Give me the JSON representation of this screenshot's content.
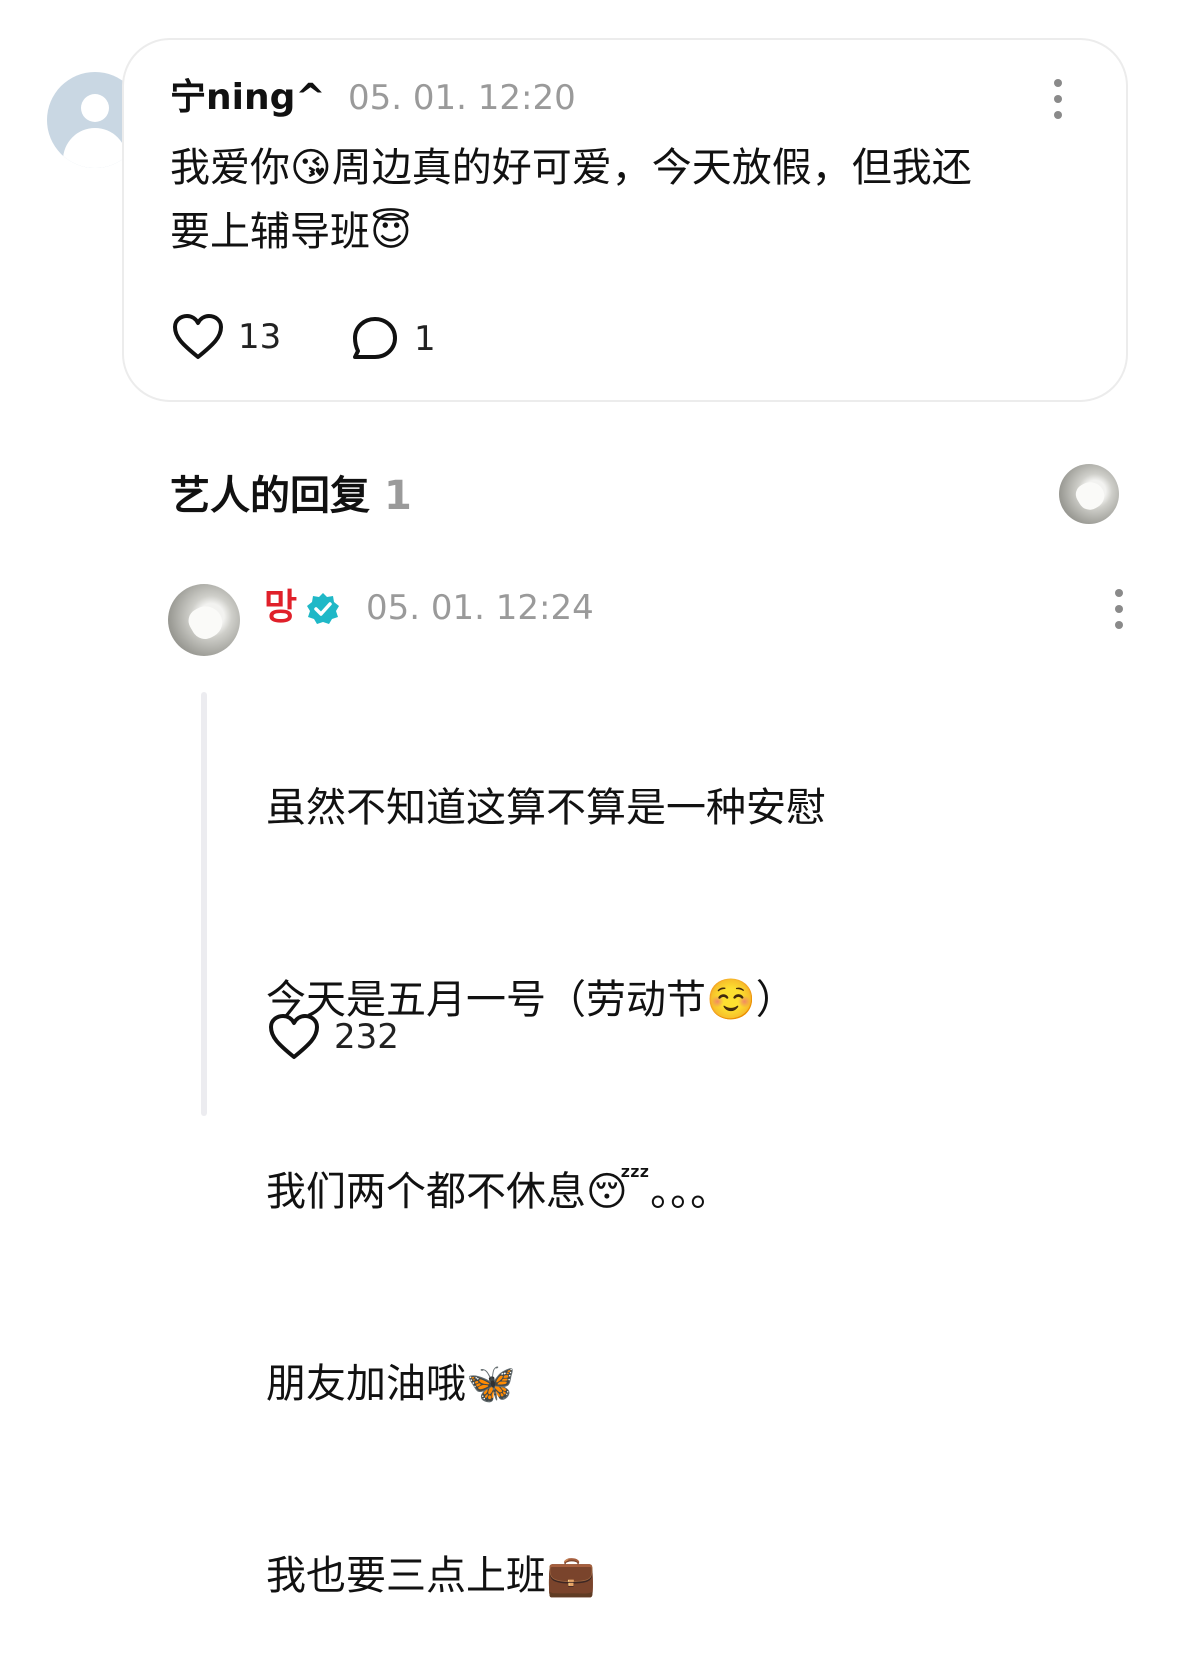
{
  "comment": {
    "username": "宁ning^",
    "time": "05. 01. 12:20",
    "text": "我爱你😘周边真的好可爱，今天放假，但我还\n要上辅导班😇",
    "likes": "13",
    "replies": "1",
    "icons": {
      "like": "heart-outline-icon",
      "reply": "speech-bubble-icon",
      "more": "kebab-menu-icon"
    }
  },
  "artist_replies": {
    "title": "艺人的回复",
    "count": "1"
  },
  "reply": {
    "username": "망",
    "verified": true,
    "time": "05. 01. 12:24",
    "lines": [
      "虽然不知道这算不算是一种安慰",
      "今天是五月一号（劳动节☺️）",
      "我们两个都不休息😴。。。",
      "朋友加油哦🦋",
      "我也要三点上班💼"
    ],
    "likes": "232"
  },
  "colors": {
    "artist_name": "#e0202a",
    "verified_badge": "#1fb8c7",
    "muted_text": "#9a9a9a",
    "card_border": "#ececec"
  }
}
